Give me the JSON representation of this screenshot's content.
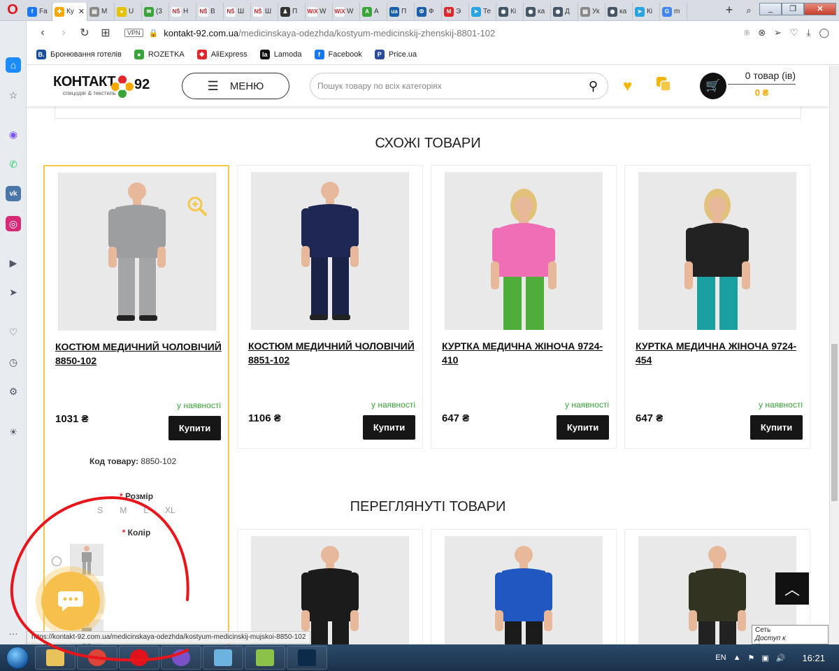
{
  "browser": {
    "tabs": [
      {
        "label": "Fa",
        "color": "#1877f2",
        "glyph": "f"
      },
      {
        "label": "Ку",
        "color": "#f5a800",
        "glyph": "✚",
        "active": true
      },
      {
        "label": "М",
        "color": "#888888",
        "glyph": "▤"
      },
      {
        "label": "U",
        "color": "#e6c200",
        "glyph": "●"
      },
      {
        "label": "(3",
        "color": "#3aa43a",
        "glyph": "✉"
      },
      {
        "label": "Н",
        "color": "#ffffff",
        "glyph": "NŠ"
      },
      {
        "label": "В",
        "color": "#ffffff",
        "glyph": "NŠ"
      },
      {
        "label": "Ш",
        "color": "#ffffff",
        "glyph": "NŠ"
      },
      {
        "label": "Ш",
        "color": "#ffffff",
        "glyph": "NŠ"
      },
      {
        "label": "П",
        "color": "#333333",
        "glyph": "♟"
      },
      {
        "label": "W",
        "color": "#ffffff",
        "glyph": "WiX"
      },
      {
        "label": "W",
        "color": "#ffffff",
        "glyph": "WiX"
      },
      {
        "label": "A",
        "color": "#3aa43a",
        "glyph": "A"
      },
      {
        "label": "П",
        "color": "#1a5fa8",
        "glyph": "ua"
      },
      {
        "label": "Ф",
        "color": "#1a5fa8",
        "glyph": "Ф"
      },
      {
        "label": "Э",
        "color": "#e0262b",
        "glyph": "M"
      },
      {
        "label": "Те",
        "color": "#2aa3e0",
        "glyph": "➤"
      },
      {
        "label": "Кі",
        "color": "#456",
        "glyph": "◉"
      },
      {
        "label": "ка",
        "color": "#456",
        "glyph": "◉"
      },
      {
        "label": "Д",
        "color": "#456",
        "glyph": "◉"
      },
      {
        "label": "Ук",
        "color": "#888888",
        "glyph": "▤"
      },
      {
        "label": "ка",
        "color": "#456",
        "glyph": "◉"
      },
      {
        "label": "Кі",
        "color": "#2aa3e0",
        "glyph": "➤"
      },
      {
        "label": "m",
        "color": "#4285f4",
        "glyph": "G"
      }
    ],
    "url_domain": "kontakt-92.com.ua",
    "url_path": "/medicinskaya-odezhda/kostyum-medicinskij-zhenskij-8801-102",
    "vpn": "VPN",
    "bookmarks": [
      {
        "label": "Бронювання готелів",
        "icon": "B.",
        "color": "#1a4fa0"
      },
      {
        "label": "ROZETKA",
        "icon": "●",
        "color": "#3aa43a"
      },
      {
        "label": "AliExpress",
        "icon": "◆",
        "color": "#e0262b"
      },
      {
        "label": "Lamoda",
        "icon": "la",
        "color": "#111111"
      },
      {
        "label": "Facebook",
        "icon": "f",
        "color": "#1877f2"
      },
      {
        "label": "Price.ua",
        "icon": "P",
        "color": "#2b4a9b"
      }
    ],
    "status_url": "https://kontakt-92.com.ua/medicinskaya-odezhda/kostyum-medicinskij-mujskoi-8850-102"
  },
  "header": {
    "logo_text": "КОНТАКТ",
    "logo_num": "92",
    "logo_sub": "спецодяг & текстиль",
    "menu_label": "МЕНЮ",
    "search_placeholder": "Пошук товару по всіх категоріях",
    "cart_count": "0 товар (ів)",
    "cart_sum": "0 ₴"
  },
  "similar": {
    "title": "СХОЖІ ТОВАРИ",
    "products": [
      {
        "name": "КОСТЮМ МЕДИЧНИЙ ЧОЛОВІЧИЙ 8850-102",
        "availability": "у наявності",
        "price": "1031 ₴",
        "buy": "Купити",
        "figure": "man",
        "top": "#9c9ea0",
        "bottom": "#a3a5a7"
      },
      {
        "name": "КОСТЮМ МЕДИЧНИЙ ЧОЛОВІЧИЙ 8851-102",
        "availability": "у наявності",
        "price": "1106 ₴",
        "buy": "Купити",
        "figure": "man",
        "top": "#1f2855",
        "bottom": "#1a2247"
      },
      {
        "name": "КУРТКА МЕДИЧНА ЖІНОЧА 9724-410",
        "availability": "у наявності",
        "price": "647 ₴",
        "buy": "Купити",
        "figure": "woman",
        "top": "#ee6fb3",
        "bottom": "#4fae3a"
      },
      {
        "name": "КУРТКА МЕДИЧНА ЖІНОЧА 9724-454",
        "availability": "у наявності",
        "price": "647 ₴",
        "buy": "Купити",
        "figure": "woman",
        "top": "#222222",
        "bottom": "#1aa0a0"
      }
    ]
  },
  "highlight_card": {
    "code_label": "Код товару:",
    "code_value": "8850-102",
    "size_label": "Розмір",
    "sizes": [
      "S",
      "M",
      "L",
      "XL"
    ],
    "color_label": "Колір",
    "required_mark": "*"
  },
  "viewed": {
    "title": "ПЕРЕГЛЯНУТІ ТОВАРИ",
    "products": [
      {
        "figure": "man",
        "top": "#1b1b1b",
        "bottom": "#1b1b1b"
      },
      {
        "figure": "man",
        "top": "#2057c0",
        "bottom": "#1b1b1b"
      },
      {
        "figure": "man",
        "top": "#333322",
        "bottom": "#222222"
      }
    ]
  },
  "tooltip": {
    "line1": "Сеть",
    "line2": "Доступ к Интернету"
  },
  "taskbar": {
    "apps": [
      {
        "name": "explorer",
        "color": "#e8c25a"
      },
      {
        "name": "chrome",
        "color": "#db4437"
      },
      {
        "name": "opera",
        "color": "#e0121b"
      },
      {
        "name": "viber",
        "color": "#7b51c9"
      },
      {
        "name": "notepad",
        "color": "#6db3e0"
      },
      {
        "name": "notepad-plus",
        "color": "#8bc34a"
      },
      {
        "name": "photoshop",
        "color": "#0c2a4a"
      }
    ],
    "lang": "EN",
    "time": "16:21"
  }
}
